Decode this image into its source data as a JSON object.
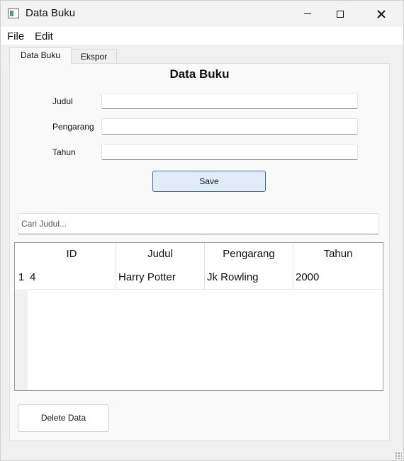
{
  "window": {
    "title": "Data Buku"
  },
  "menubar": {
    "items": [
      "File",
      "Edit"
    ]
  },
  "tabs": [
    {
      "label": "Data Buku",
      "active": true
    },
    {
      "label": "Ekspor",
      "active": false
    }
  ],
  "form": {
    "title": "Data Buku",
    "fields": [
      {
        "label": "Judul",
        "value": ""
      },
      {
        "label": "Pengarang",
        "value": ""
      },
      {
        "label": "Tahun",
        "value": ""
      }
    ],
    "save_label": "Save"
  },
  "search": {
    "placeholder": "Cari Judul..."
  },
  "table": {
    "columns": [
      "ID",
      "Judul",
      "Pengarang",
      "Tahun"
    ],
    "rows": [
      {
        "row_number": "1",
        "cells": [
          "4",
          "Harry Potter",
          "Jk Rowling",
          "2000"
        ]
      }
    ]
  },
  "actions": {
    "delete_label": "Delete Data"
  },
  "colors": {
    "accent": "#2f6fc1",
    "save_bg": "#e1ecf8"
  }
}
